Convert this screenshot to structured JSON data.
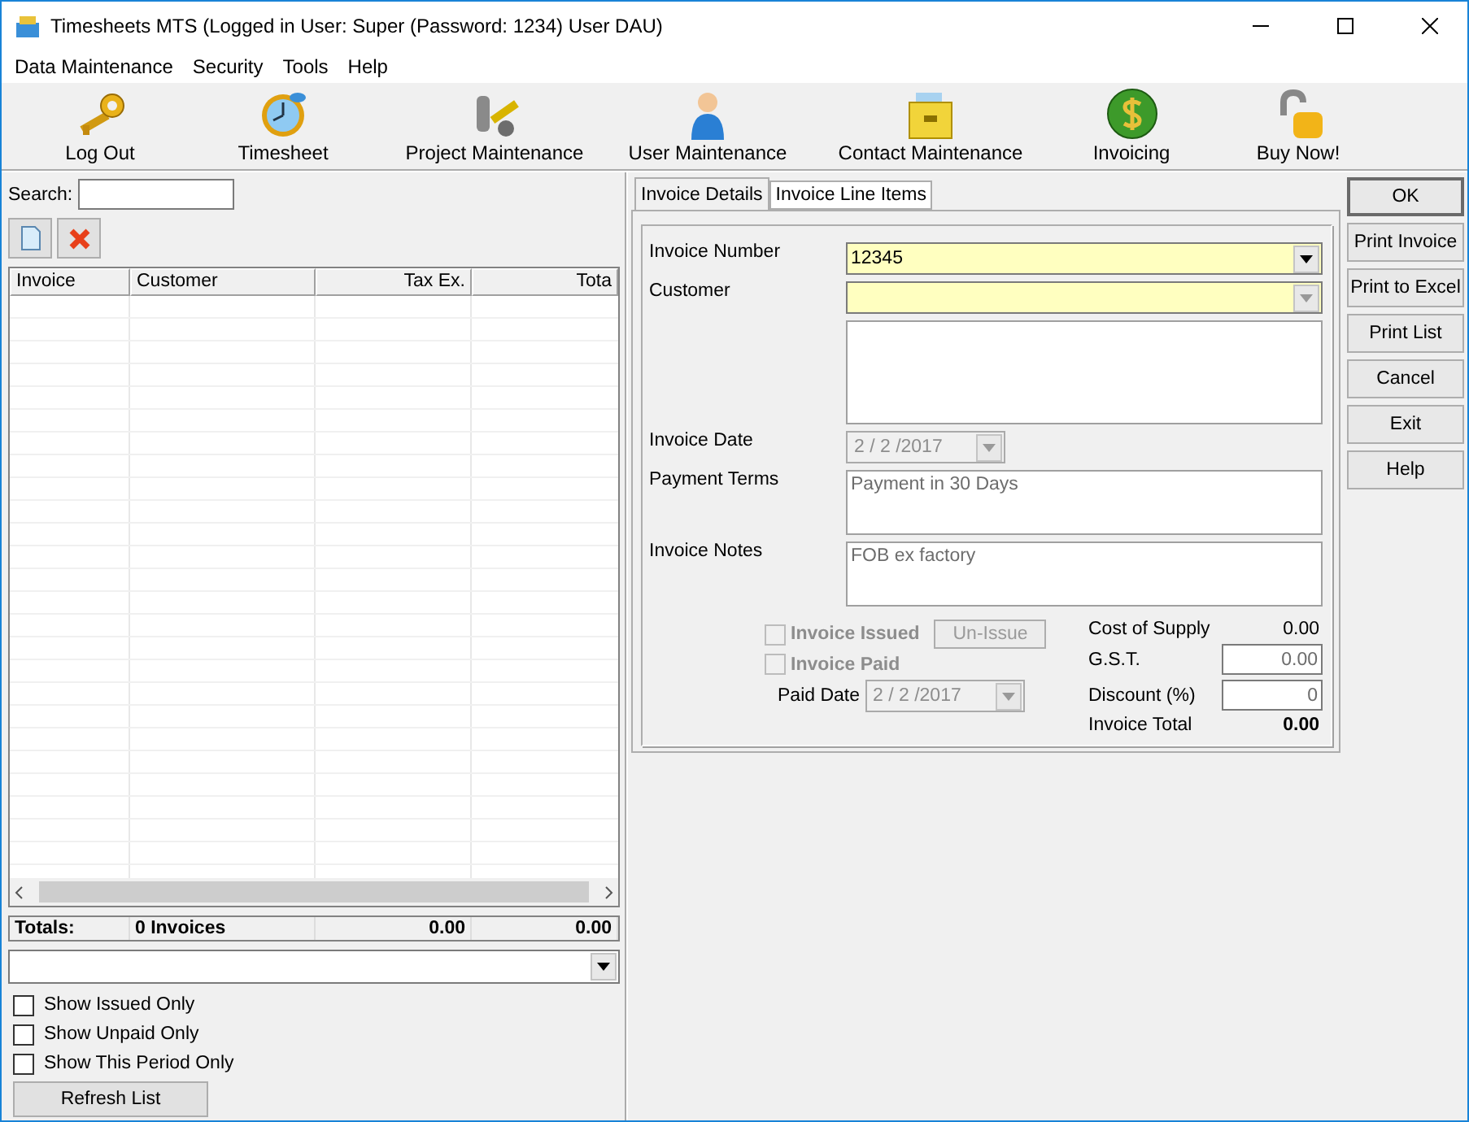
{
  "window": {
    "title": "Timesheets MTS (Logged in User: Super (Password: 1234) User DAU)"
  },
  "menu": [
    "Data Maintenance",
    "Security",
    "Tools",
    "Help"
  ],
  "toolbar": [
    {
      "label": "Log Out",
      "kind": "key"
    },
    {
      "label": "Timesheet",
      "kind": "clock"
    },
    {
      "label": "Project Maintenance",
      "kind": "tools"
    },
    {
      "label": "User Maintenance",
      "kind": "user"
    },
    {
      "label": "Contact Maintenance",
      "kind": "cabinet"
    },
    {
      "label": "Invoicing",
      "kind": "dollar"
    },
    {
      "label": "Buy Now!",
      "kind": "lock"
    }
  ],
  "list": {
    "search_label": "Search:",
    "columns": [
      "Invoice",
      "Customer",
      "Tax Ex.",
      "Tota"
    ],
    "totals": [
      "Totals:",
      "0 Invoices",
      "0.00",
      "0.00"
    ],
    "filters": [
      {
        "label": "Show Issued Only",
        "checked": false
      },
      {
        "label": "Show Unpaid Only",
        "checked": false
      },
      {
        "label": "Show This Period Only",
        "checked": false
      }
    ],
    "refresh": "Refresh List"
  },
  "tabs": [
    {
      "label": "Invoice Details",
      "selected": true
    },
    {
      "label": "Invoice Line Items",
      "selected": false
    }
  ],
  "form": {
    "invoice_number": {
      "label": "Invoice Number",
      "value": "12345"
    },
    "customer": {
      "label": "Customer"
    },
    "invoice_date": {
      "label": "Invoice Date",
      "value": "2 / 2 /2017",
      "disabled": true
    },
    "payment_terms": {
      "label": "Payment Terms",
      "value": "Payment in 30 Days"
    },
    "invoice_notes": {
      "label": "Invoice Notes",
      "value": "FOB ex factory"
    },
    "invoice_issued": {
      "label": "Invoice Issued",
      "checked": false,
      "disabled": true
    },
    "un_issue": {
      "label": "Un-Issue",
      "disabled": true
    },
    "invoice_paid": {
      "label": "Invoice Paid",
      "checked": false,
      "disabled": true
    },
    "paid_date": {
      "label": "Paid Date",
      "value": "2 / 2 /2017",
      "disabled": true
    },
    "cost_of_supply": {
      "label": "Cost of Supply",
      "value": "0.00"
    },
    "gst": {
      "label": "G.S.T.",
      "value": "0.00"
    },
    "discount": {
      "label": "Discount (%)",
      "value": "0"
    },
    "total": {
      "label": "Invoice Total",
      "value": "0.00"
    }
  },
  "side_buttons": [
    "OK",
    "Print Invoice",
    "Print to Excel",
    "Print List",
    "Cancel",
    "Exit",
    "Help"
  ]
}
